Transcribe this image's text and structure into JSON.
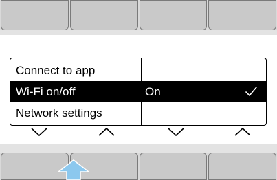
{
  "menu": {
    "rows": [
      {
        "label": "Connect to app",
        "value": ""
      },
      {
        "label": "Wi-Fi on/off",
        "value": "On",
        "selected": true,
        "checked": true
      },
      {
        "label": "Network settings",
        "value": ""
      }
    ]
  },
  "nav_arrows": [
    "chevron-down-icon",
    "chevron-up-icon",
    "chevron-down-icon",
    "chevron-up-icon"
  ],
  "pointer": {
    "icon": "up-arrow-icon",
    "color": "#8cc8ee",
    "target_key": 2
  },
  "colors": {
    "selection": "#000000",
    "key": "#c9c9c9",
    "pointer": "#8cc8ee"
  }
}
